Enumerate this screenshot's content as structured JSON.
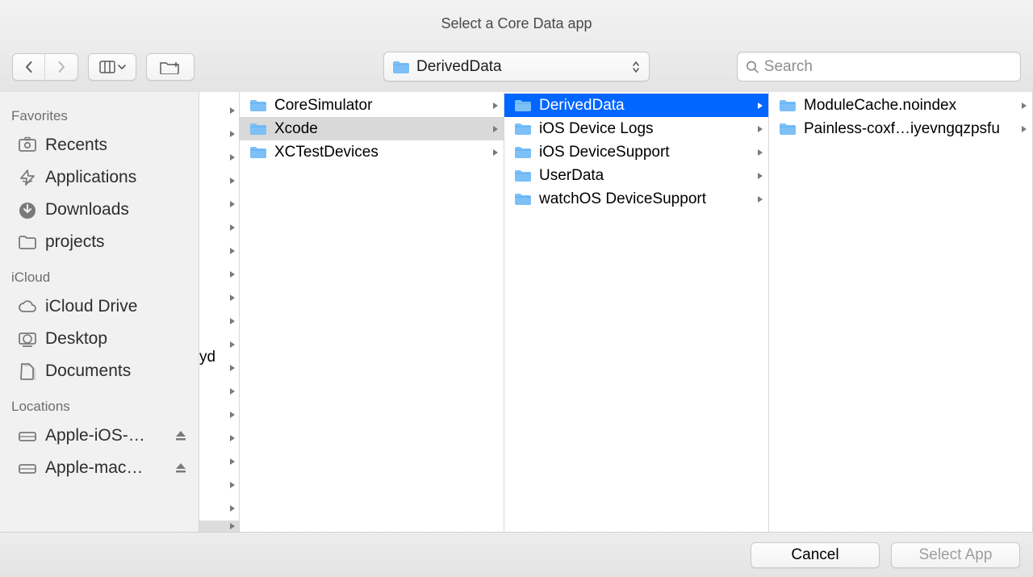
{
  "window": {
    "title": "Select a Core Data app"
  },
  "toolbar": {
    "path_label": "DerivedData",
    "search_placeholder": "Search"
  },
  "sidebar": {
    "favorites_title": "Favorites",
    "favorites": [
      {
        "icon": "recents",
        "label": "Recents"
      },
      {
        "icon": "applications",
        "label": "Applications"
      },
      {
        "icon": "downloads",
        "label": "Downloads"
      },
      {
        "icon": "folder",
        "label": "projects"
      }
    ],
    "icloud_title": "iCloud",
    "icloud": [
      {
        "icon": "cloud",
        "label": "iCloud Drive"
      },
      {
        "icon": "desktop",
        "label": "Desktop"
      },
      {
        "icon": "documents",
        "label": "Documents"
      }
    ],
    "locations_title": "Locations",
    "locations": [
      {
        "icon": "drive",
        "label": "Apple-iOS-…",
        "eject": true
      },
      {
        "icon": "drive",
        "label": "Apple-mac…",
        "eject": true
      }
    ]
  },
  "col0": {
    "partial_text": "yd",
    "arrow_rows": 18
  },
  "col1": [
    {
      "label": "CoreSimulator",
      "selected": false
    },
    {
      "label": "Xcode",
      "selected": "gray"
    },
    {
      "label": "XCTestDevices",
      "selected": false
    }
  ],
  "col2": [
    {
      "label": "DerivedData",
      "selected": "blue"
    },
    {
      "label": "iOS Device Logs",
      "selected": false
    },
    {
      "label": "iOS DeviceSupport",
      "selected": false
    },
    {
      "label": "UserData",
      "selected": false
    },
    {
      "label": "watchOS DeviceSupport",
      "selected": false
    }
  ],
  "col3": [
    {
      "label": "ModuleCache.noindex",
      "selected": false
    },
    {
      "label": "Painless-coxf…iyevngqzpsfu",
      "selected": false
    }
  ],
  "buttons": {
    "cancel": "Cancel",
    "select": "Select App"
  }
}
